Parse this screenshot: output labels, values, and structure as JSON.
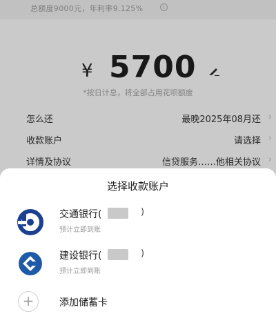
{
  "top_info": {
    "text": "总额度9000元，年利率9.125%"
  },
  "loan": {
    "currency_symbol": "¥",
    "amount": "5700",
    "note": "*按日计息，将全部占用花呗额度"
  },
  "rows": [
    {
      "label": "怎么还",
      "value": "最晚2025年08月还"
    },
    {
      "label": "收款账户",
      "value": "请选择"
    },
    {
      "label": "详情及协议",
      "value": "信贷服务……他相关协议"
    }
  ],
  "sheet": {
    "title": "选择收款账户",
    "banks": [
      {
        "name": "交通银行(",
        "paren": ")",
        "sub": "预计立即到账",
        "logo": "bocom-logo"
      },
      {
        "name": "建设银行(",
        "paren": ")",
        "sub": "预计立即到账",
        "logo": "ccb-logo"
      }
    ],
    "add_card": {
      "icon": "plus-icon",
      "label": "添加储蓄卡"
    }
  },
  "colors": {
    "bocom_blue": "#1c3f8f",
    "ccb_blue": "#1f5aa8",
    "mask_gray": "#c9c9c9"
  }
}
